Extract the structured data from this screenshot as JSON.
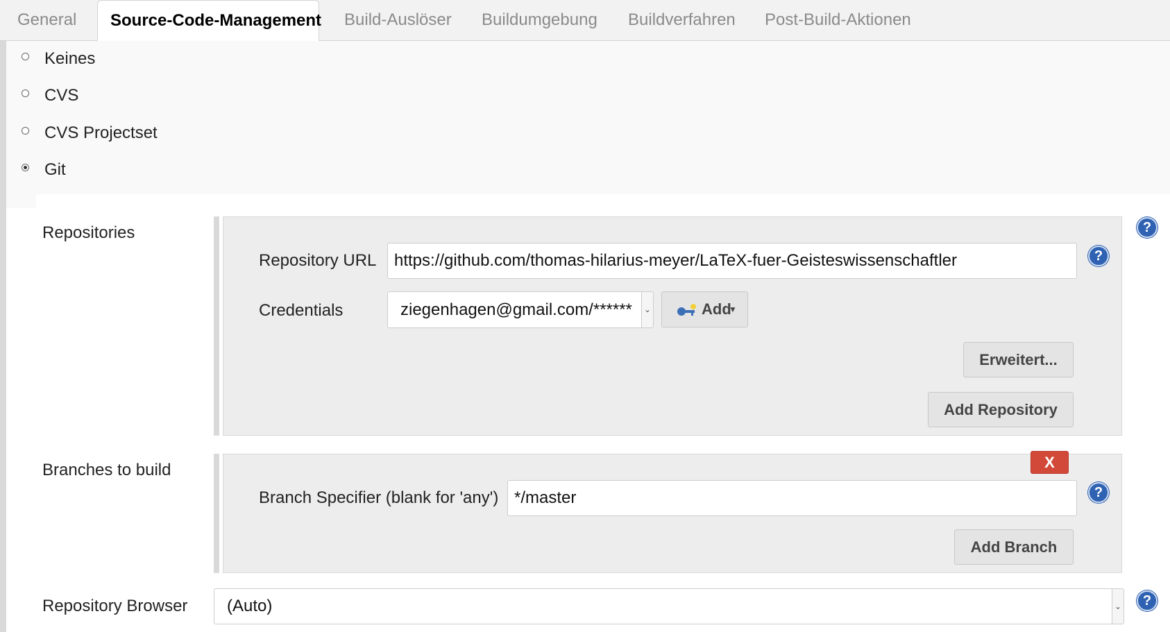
{
  "tabs": [
    {
      "label": "General",
      "active": false
    },
    {
      "label": "Source-Code-Management",
      "active": true
    },
    {
      "label": "Build-Auslöser",
      "active": false
    },
    {
      "label": "Buildumgebung",
      "active": false
    },
    {
      "label": "Buildverfahren",
      "active": false
    },
    {
      "label": "Post-Build-Aktionen",
      "active": false
    }
  ],
  "scm": {
    "options": [
      {
        "label": "Keines",
        "selected": false
      },
      {
        "label": "CVS",
        "selected": false
      },
      {
        "label": "CVS Projectset",
        "selected": false
      },
      {
        "label": "Git",
        "selected": true
      }
    ]
  },
  "repositories": {
    "label": "Repositories",
    "url_label": "Repository URL",
    "url_value": "https://github.com/thomas-hilarius-meyer/LaTeX-fuer-Geisteswissenschaftler",
    "credentials_label": "Credentials",
    "credentials_value": "ziegenhagen@gmail.com/******",
    "add_label": "Add",
    "advanced_label": "Erweitert...",
    "add_repository_label": "Add Repository"
  },
  "branches": {
    "label": "Branches to build",
    "delete_label": "X",
    "specifier_label": "Branch Specifier (blank for 'any')",
    "specifier_value": "*/master",
    "add_branch_label": "Add Branch"
  },
  "browser": {
    "label": "Repository Browser",
    "value": "(Auto)"
  },
  "help_glyph": "?",
  "icons": {
    "help": "help-icon",
    "key": "key-icon",
    "dropdown": "dropdown-arrow-icon"
  },
  "colors": {
    "help_blue": "#2f62b2",
    "delete_red": "#d24939",
    "panel_gray": "#ededed"
  }
}
